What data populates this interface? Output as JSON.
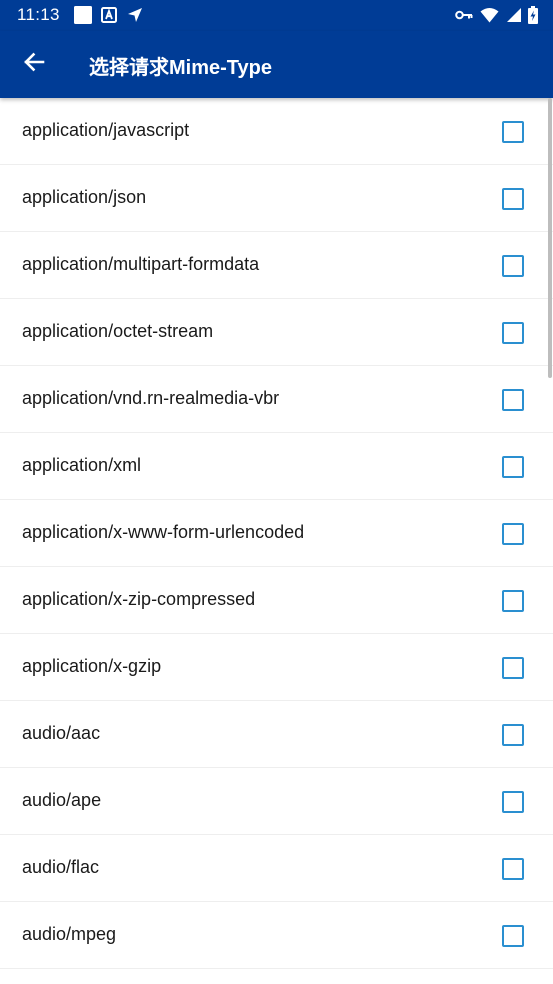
{
  "status_bar": {
    "time": "11:13",
    "background": "#003c96",
    "left_icons": [
      "square-notification-icon",
      "font-a-icon",
      "location-arrow-icon"
    ],
    "right_icons": [
      "vpn-key-icon",
      "wifi-icon",
      "signal-icon",
      "battery-charging-icon"
    ]
  },
  "app_bar": {
    "title": "选择请求Mime-Type",
    "back_icon": "arrow-left-icon",
    "background": "#003c96"
  },
  "list": {
    "checkbox_color": "#2a8fd0",
    "items": [
      {
        "label": "application/javascript",
        "checked": false
      },
      {
        "label": "application/json",
        "checked": false
      },
      {
        "label": "application/multipart-formdata",
        "checked": false
      },
      {
        "label": "application/octet-stream",
        "checked": false
      },
      {
        "label": "application/vnd.rn-realmedia-vbr",
        "checked": false
      },
      {
        "label": "application/xml",
        "checked": false
      },
      {
        "label": "application/x-www-form-urlencoded",
        "checked": false
      },
      {
        "label": "application/x-zip-compressed",
        "checked": false
      },
      {
        "label": "application/x-gzip",
        "checked": false
      },
      {
        "label": "audio/aac",
        "checked": false
      },
      {
        "label": "audio/ape",
        "checked": false
      },
      {
        "label": "audio/flac",
        "checked": false
      },
      {
        "label": "audio/mpeg",
        "checked": false
      }
    ]
  }
}
